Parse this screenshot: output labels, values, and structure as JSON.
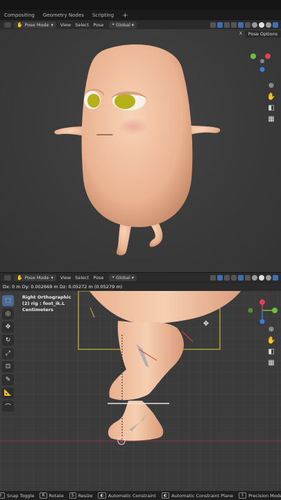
{
  "workspace_tabs": [
    "Compositing",
    "Geometry Nodes",
    "Scripting"
  ],
  "add_tab": "+",
  "top_header": {
    "mode": "Pose Mode",
    "menus": [
      "View",
      "Select",
      "Pose"
    ],
    "orientation": "Global"
  },
  "pose_options": "Pose Options",
  "x_label": "X",
  "bottom_header": {
    "mode": "Pose Mode",
    "menus": [
      "View",
      "Select",
      "Pose"
    ],
    "orientation": "Global"
  },
  "delta_readout": "Dx: 0 m  Dy: 0.002669 m  Dz: 0.05272 m (0.05279 m)",
  "viewport_info": {
    "view": "Right Orthographic",
    "object": "(2) rig : foot_ik.L",
    "units": "Centimeters"
  },
  "status_bar": {
    "items": [
      {
        "key": "",
        "label": "Snap Toggle"
      },
      {
        "key": "R",
        "label": "Rotate"
      },
      {
        "key": "S",
        "label": "Resize"
      },
      {
        "key": "",
        "label": "Automatic Constraint"
      },
      {
        "key": "",
        "label": "Automatic Constraint Plane"
      },
      {
        "key": "",
        "label": "Precision Mode"
      }
    ]
  },
  "gizmo": {
    "x_label": "X",
    "y_label": "Y",
    "z_label": "Z",
    "x_color": "#e0424f",
    "y_color": "#6ac13a",
    "z_color": "#3e7be0"
  },
  "colors": {
    "skin": "#f2c3a2",
    "eye_iris": "#b6b018",
    "bounding_box": "#c9b532",
    "bone": "#e6e6e6"
  }
}
